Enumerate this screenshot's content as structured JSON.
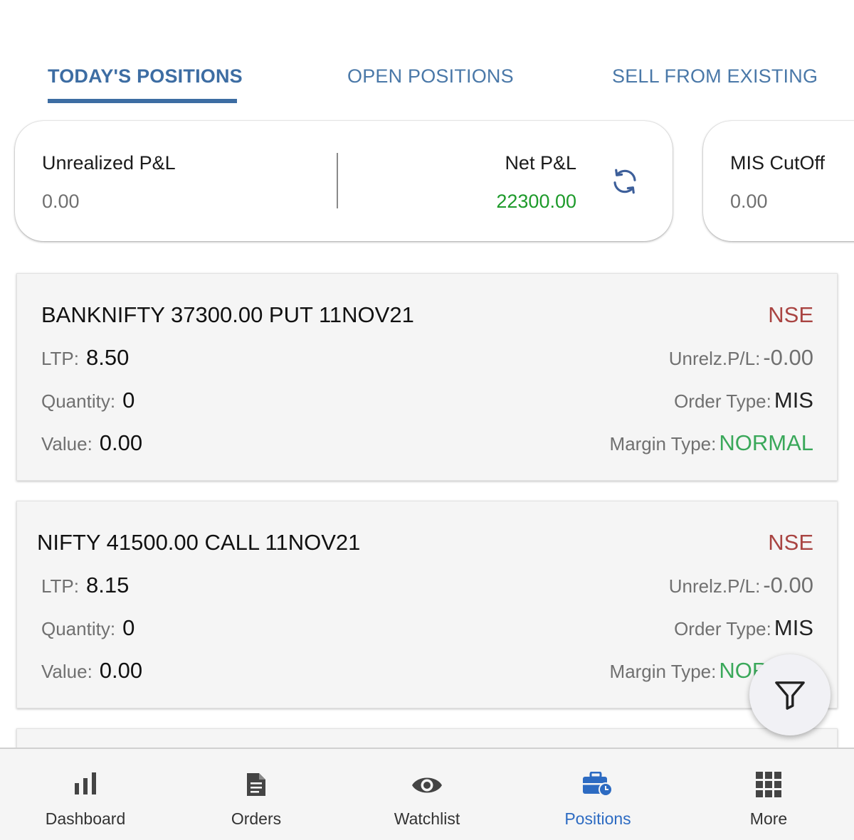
{
  "tabs": [
    {
      "label": "TODAY'S POSITIONS",
      "active": true
    },
    {
      "label": "OPEN POSITIONS",
      "active": false
    },
    {
      "label": "SELL FROM EXISTING",
      "active": false
    }
  ],
  "summary": {
    "unrealized_label": "Unrealized P&L",
    "unrealized_value": "0.00",
    "net_label": "Net P&L",
    "net_value": "22300.00",
    "net_value_color": "#1d9a2a",
    "refresh_icon": "refresh-icon",
    "mis_label": "MIS CutOff",
    "mis_value": "0.00"
  },
  "positions": [
    {
      "symbol": "BANKNIFTY 37300.00 PUT 11NOV21",
      "exchange": "NSE",
      "ltp_label": "LTP:",
      "ltp": "8.50",
      "qty_label": "Quantity:",
      "qty": "0",
      "value_label": "Value:",
      "value": "0.00",
      "unrlz_label": "Unrelz.P/L:",
      "unrlz": "-0.00",
      "order_type_label": "Order Type:",
      "order_type": "MIS",
      "margin_type_label": "Margin Type:",
      "margin_type": "NORMAL"
    },
    {
      "symbol": "NIFTY 41500.00 CALL 11NOV21",
      "exchange": "NSE",
      "ltp_label": "LTP:",
      "ltp": "8.15",
      "qty_label": "Quantity:",
      "qty": "0",
      "value_label": "Value:",
      "value": "0.00",
      "unrlz_label": "Unrelz.P/L:",
      "unrlz": "-0.00",
      "order_type_label": "Order Type:",
      "order_type": "MIS",
      "margin_type_label": "Margin Type:",
      "margin_type": "NORMAL"
    }
  ],
  "fab": {
    "icon": "filter-icon"
  },
  "nav": [
    {
      "label": "Dashboard",
      "icon": "bar-chart-icon",
      "active": false
    },
    {
      "label": "Orders",
      "icon": "document-icon",
      "active": false
    },
    {
      "label": "Watchlist",
      "icon": "eye-icon",
      "active": false
    },
    {
      "label": "Positions",
      "icon": "briefcase-clock-icon",
      "active": true
    },
    {
      "label": "More",
      "icon": "grid-icon",
      "active": false
    }
  ],
  "colors": {
    "accent": "#3d6da3",
    "exchange": "#a94442",
    "positive": "#1d9a2a",
    "margin_type": "#3aa85a",
    "nav_active": "#2d6bc2"
  }
}
